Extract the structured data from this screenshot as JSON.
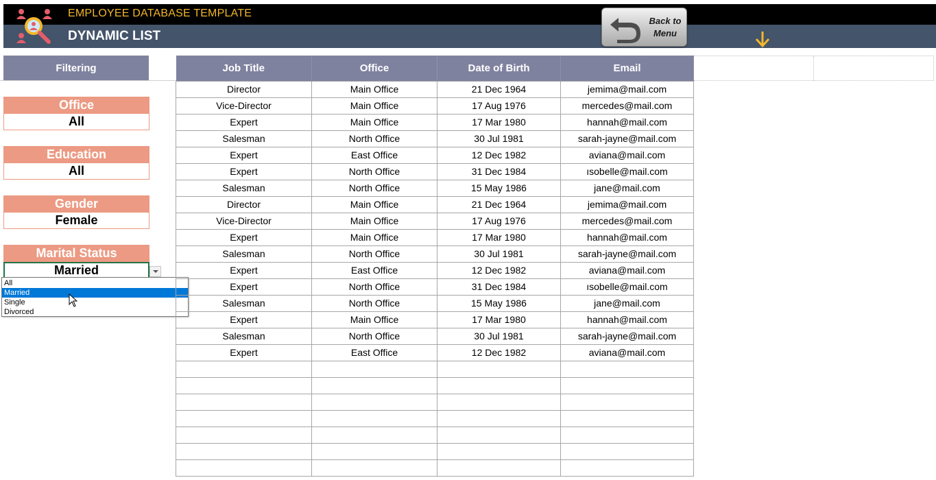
{
  "header": {
    "app_title": "EMPLOYEE DATABASE TEMPLATE",
    "page_title": "DYNAMIC LIST",
    "back_button_line1": "Back to",
    "back_button_line2": "Menu",
    "logo_icon": "people-search-icon",
    "accent_color": "#f4b72a"
  },
  "filtering": {
    "header": "Filtering",
    "filters": [
      {
        "label": "Office",
        "value": "All"
      },
      {
        "label": "Education",
        "value": "All"
      },
      {
        "label": "Gender",
        "value": "Female"
      },
      {
        "label": "Marital Status",
        "value": "Married"
      }
    ],
    "dropdown_options": [
      "All",
      "Married",
      "Single",
      "Divorced"
    ],
    "dropdown_selected": "Married"
  },
  "table": {
    "columns": [
      "Job Title",
      "Office",
      "Date of Birth",
      "Email"
    ],
    "rows": [
      [
        "Director",
        "Main Office",
        "21 Dec 1964",
        "jemima@mail.com"
      ],
      [
        "Vice-Director",
        "Main Office",
        "17 Aug 1976",
        "mercedes@mail.com"
      ],
      [
        "Expert",
        "Main Office",
        "17 Mar 1980",
        "hannah@mail.com"
      ],
      [
        "Salesman",
        "North Office",
        "30 Jul 1981",
        "sarah-jayne@mail.com"
      ],
      [
        "Expert",
        "East Office",
        "12 Dec 1982",
        "aviana@mail.com"
      ],
      [
        "Expert",
        "North Office",
        "31 Dec 1984",
        "ısobelle@mail.com"
      ],
      [
        "Salesman",
        "North Office",
        "15 May 1986",
        "jane@mail.com"
      ],
      [
        "Director",
        "Main Office",
        "21 Dec 1964",
        "jemima@mail.com"
      ],
      [
        "Vice-Director",
        "Main Office",
        "17 Aug 1976",
        "mercedes@mail.com"
      ],
      [
        "Expert",
        "Main Office",
        "17 Mar 1980",
        "hannah@mail.com"
      ],
      [
        "Salesman",
        "North Office",
        "30 Jul 1981",
        "sarah-jayne@mail.com"
      ],
      [
        "Expert",
        "East Office",
        "12 Dec 1982",
        "aviana@mail.com"
      ],
      [
        "Expert",
        "North Office",
        "31 Dec 1984",
        "ısobelle@mail.com"
      ],
      [
        "Salesman",
        "North Office",
        "15 May 1986",
        "jane@mail.com"
      ],
      [
        "Expert",
        "Main Office",
        "17 Mar 1980",
        "hannah@mail.com"
      ],
      [
        "Salesman",
        "North Office",
        "30 Jul 1981",
        "sarah-jayne@mail.com"
      ],
      [
        "Expert",
        "East Office",
        "12 Dec 1982",
        "aviana@mail.com"
      ],
      [
        "",
        "",
        "",
        ""
      ],
      [
        "",
        "",
        "",
        ""
      ],
      [
        "",
        "",
        "",
        ""
      ],
      [
        "",
        "",
        "",
        ""
      ],
      [
        "",
        "",
        "",
        ""
      ],
      [
        "",
        "",
        "",
        ""
      ],
      [
        "",
        "",
        "",
        ""
      ]
    ]
  }
}
